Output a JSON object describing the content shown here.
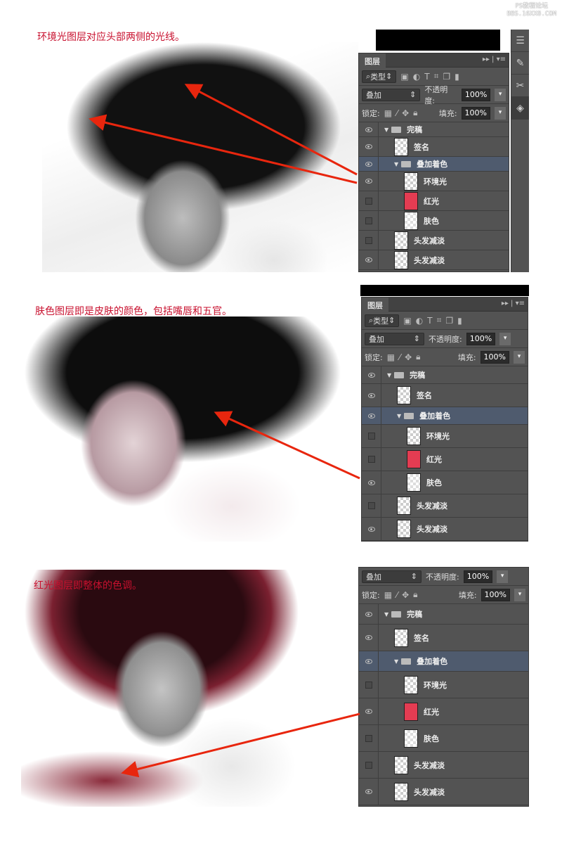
{
  "watermark": {
    "line1": "PS教程论坛",
    "line2": "BBS.16XX8.COM"
  },
  "captions": [
    "环境光图层对应头部两侧的光线。",
    "肤色图层即是皮肤的颜色，包括嘴唇和五官。",
    "红光图层即整体的色调。"
  ],
  "accent_color": "#c8102e",
  "arrow_color": "#e8260e",
  "panel": {
    "tab": "图层",
    "filter": "类型",
    "blend_mode": "叠加",
    "opacity_label": "不透明度:",
    "opacity": "100%",
    "lock_label": "锁定:",
    "fill_label": "填充:",
    "fill": "100%"
  },
  "panels": [
    {
      "layers": [
        {
          "name": "完稿",
          "type": "group",
          "visible": true
        },
        {
          "name": "签名",
          "type": "layer",
          "visible": true
        },
        {
          "name": "叠加着色",
          "type": "group",
          "visible": true,
          "selected": true
        },
        {
          "name": "环境光",
          "type": "layer",
          "visible": true
        },
        {
          "name": "红光",
          "type": "red",
          "visible": false
        },
        {
          "name": "肤色",
          "type": "skin",
          "visible": false
        },
        {
          "name": "头发减淡",
          "type": "layer",
          "visible": false
        },
        {
          "name": "头发减淡",
          "type": "layer",
          "visible": true
        }
      ]
    },
    {
      "layers": [
        {
          "name": "完稿",
          "type": "group",
          "visible": true
        },
        {
          "name": "签名",
          "type": "layer",
          "visible": true
        },
        {
          "name": "叠加着色",
          "type": "group",
          "visible": true,
          "selected": true
        },
        {
          "name": "环境光",
          "type": "layer",
          "visible": false
        },
        {
          "name": "红光",
          "type": "red",
          "visible": false
        },
        {
          "name": "肤色",
          "type": "skin",
          "visible": true
        },
        {
          "name": "头发减淡",
          "type": "layer",
          "visible": false
        },
        {
          "name": "头发减淡",
          "type": "layer",
          "visible": true
        }
      ]
    },
    {
      "layers": [
        {
          "name": "完稿",
          "type": "group",
          "visible": true
        },
        {
          "name": "签名",
          "type": "layer",
          "visible": true
        },
        {
          "name": "叠加着色",
          "type": "group",
          "visible": true,
          "selected": true
        },
        {
          "name": "环境光",
          "type": "layer",
          "visible": false
        },
        {
          "name": "红光",
          "type": "red",
          "visible": true
        },
        {
          "name": "肤色",
          "type": "skin",
          "visible": false
        },
        {
          "name": "头发减淡",
          "type": "layer",
          "visible": false
        },
        {
          "name": "头发减淡",
          "type": "layer",
          "visible": true
        }
      ]
    }
  ]
}
